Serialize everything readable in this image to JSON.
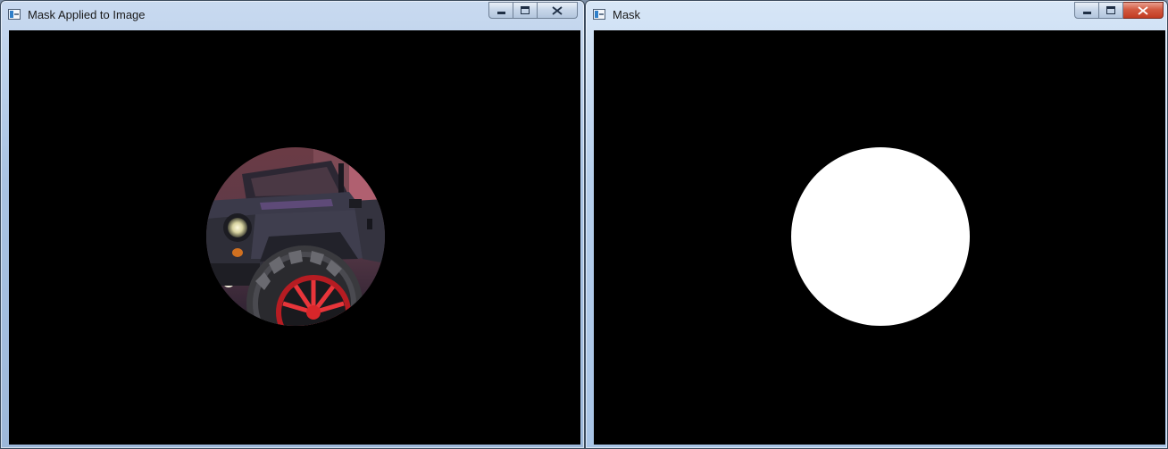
{
  "windows": [
    {
      "title": "Mask Applied to Image",
      "content": "masked-photo"
    },
    {
      "title": "Mask",
      "content": "mask-circle"
    }
  ],
  "colors": {
    "canvas_background": "#000000",
    "mask_fill": "#ffffff",
    "wheel_rim": "#d8262a",
    "vehicle_body": "#3b3a4a",
    "accent_text": "#9a3fa0",
    "close_button": "#c23b22"
  },
  "icons": {
    "app": "app-window-icon",
    "minimize": "minimize-icon",
    "maximize": "maximize-icon",
    "close": "close-icon"
  }
}
